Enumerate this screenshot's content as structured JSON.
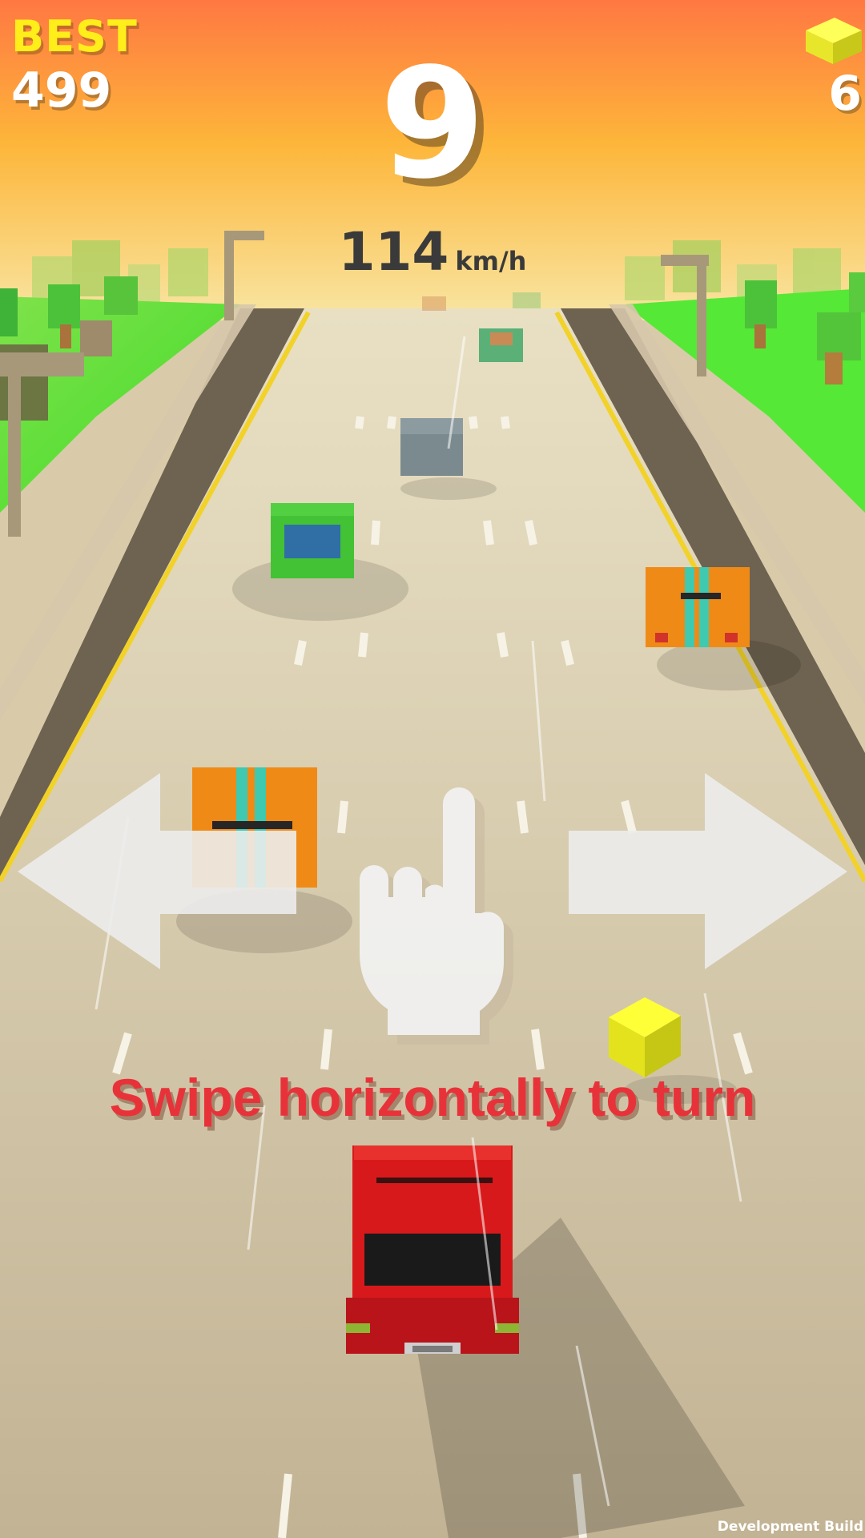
{
  "hud": {
    "best_label": "BEST",
    "best_value": "499",
    "score": "9",
    "speed_value": "114",
    "speed_unit": "km/h",
    "cube_count": "6"
  },
  "tutorial": {
    "hint": "Swipe horizontally to turn"
  },
  "footer": {
    "build_label": "Development Build"
  },
  "icons": {
    "cube": "cube-icon",
    "left_arrow": "arrow-left-icon",
    "right_arrow": "arrow-right-icon",
    "hand": "pointing-hand-icon"
  },
  "colors": {
    "sky_top": "#ff7a40",
    "sky_bottom": "#f9e9a0",
    "grass": "#5ee83a",
    "road": "#c8b99c",
    "player_car": "#d8191b",
    "hint_text": "#e8323a",
    "best_label": "#ffee1a"
  }
}
